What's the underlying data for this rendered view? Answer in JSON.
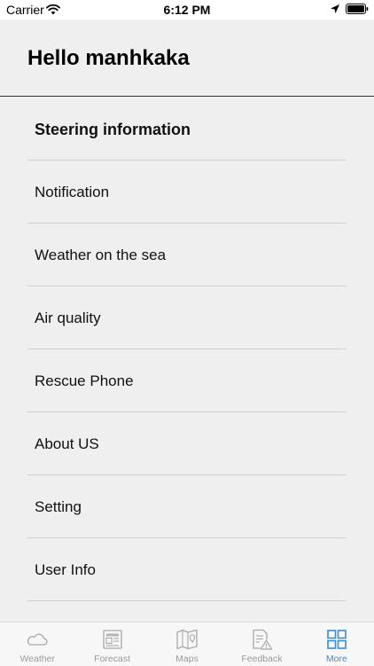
{
  "status_bar": {
    "carrier": "Carrier",
    "time": "6:12 PM"
  },
  "header": {
    "title": "Hello manhkaka"
  },
  "menu": {
    "items": [
      {
        "label": "Steering information"
      },
      {
        "label": "Notification"
      },
      {
        "label": "Weather on the sea"
      },
      {
        "label": "Air quality"
      },
      {
        "label": "Rescue Phone"
      },
      {
        "label": "About US"
      },
      {
        "label": "Setting"
      },
      {
        "label": "User Info"
      }
    ]
  },
  "tab_bar": {
    "tabs": [
      {
        "label": "Weather",
        "icon": "cloud-icon"
      },
      {
        "label": "Forecast",
        "icon": "newspaper-icon"
      },
      {
        "label": "Maps",
        "icon": "map-icon"
      },
      {
        "label": "Feedback",
        "icon": "feedback-icon"
      },
      {
        "label": "More",
        "icon": "grid-icon"
      }
    ],
    "active_color": "#3a8ed0",
    "inactive_color": "#9a9a9a"
  }
}
